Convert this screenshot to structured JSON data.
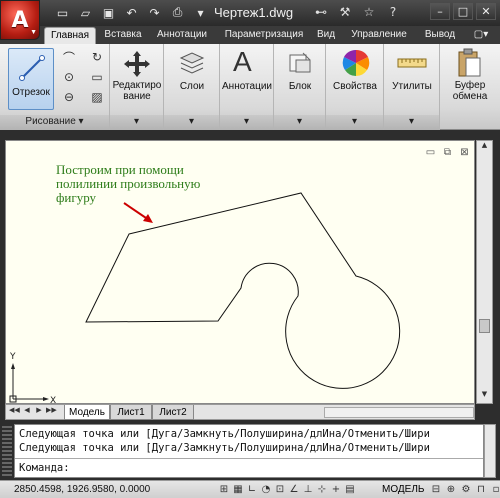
{
  "window": {
    "title": "Чертеж1.dwg"
  },
  "ribbon_tabs": [
    "Главная",
    "Вставка",
    "Аннотации",
    "Параметризация",
    "Вид",
    "Управление",
    "Вывод"
  ],
  "ribbon": {
    "draw_tool_label": "Отрезок",
    "draw_panel_title": "Рисование",
    "edit_label_line1": "Редактиро",
    "edit_label_line2": "вание",
    "layers_label": "Слои",
    "annotations_label": "Аннотации",
    "block_label": "Блок",
    "properties_label": "Свойства",
    "utilities_label": "Утилиты",
    "clipboard_label_line1": "Буфер",
    "clipboard_label_line2": "обмена",
    "annotation_glyph": "A"
  },
  "drawing": {
    "annotation_lines": [
      "Построим при помощи",
      "полилинии произвольную",
      "фигуру"
    ],
    "annotation_color": "#2e7d1a",
    "arrow_color": "#cc0000",
    "ucs_x": "X",
    "ucs_y": "Y"
  },
  "layout_tabs": [
    "Модель",
    "Лист1",
    "Лист2"
  ],
  "command_line": {
    "history": [
      "Следующая точка или [Дуга/Замкнуть/Полуширина/длИна/Отменить/Шири",
      "Следующая точка или [Дуга/Замкнуть/Полуширина/длИна/Отменить/Шири"
    ],
    "prompt": "Команда:"
  },
  "status_bar": {
    "coordinates": "2850.4598, 1926.9580, 0.0000",
    "space": "МОДЕЛЬ"
  },
  "colors": {
    "app_red": "#c0271a",
    "drawing_bg": "#fffff2",
    "chrome_dark": "#2d2d2d"
  }
}
